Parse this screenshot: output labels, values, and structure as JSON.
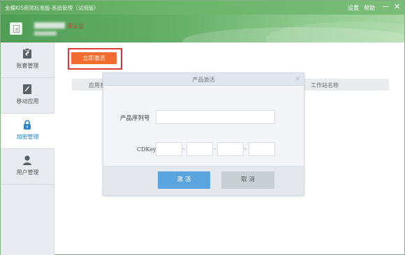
{
  "window": {
    "title": "金蝶KIS商贸标准版-系统管理（试用版）"
  },
  "titlebar": {
    "settings": "设置",
    "help": "帮助",
    "minimize": "—",
    "close": "✕"
  },
  "header": {
    "status": "未认证"
  },
  "sidebar": {
    "items": [
      {
        "label": "账套管理",
        "icon": "account-set-icon"
      },
      {
        "label": "移动应用",
        "icon": "mobile-app-icon"
      },
      {
        "label": "加密管理",
        "icon": "lock-icon"
      },
      {
        "label": "用户管理",
        "icon": "user-icon"
      }
    ],
    "active_index": 2
  },
  "main": {
    "activate_now": "立即激活",
    "table_columns": [
      "应用系",
      "工作站名称"
    ]
  },
  "modal": {
    "title": "产品激活",
    "close": "×",
    "serial_label": "产品序列号",
    "cdkey_label": "CDKey",
    "cdkey_separator": "-",
    "activate_button": "激 活",
    "cancel_button": "取 消"
  },
  "colors": {
    "titlebar": "#6eb56e",
    "accent_orange": "#f26b2f",
    "highlight_red": "#e03b31",
    "primary_blue": "#5aa4e0",
    "active_nav": "#2b83c9"
  }
}
